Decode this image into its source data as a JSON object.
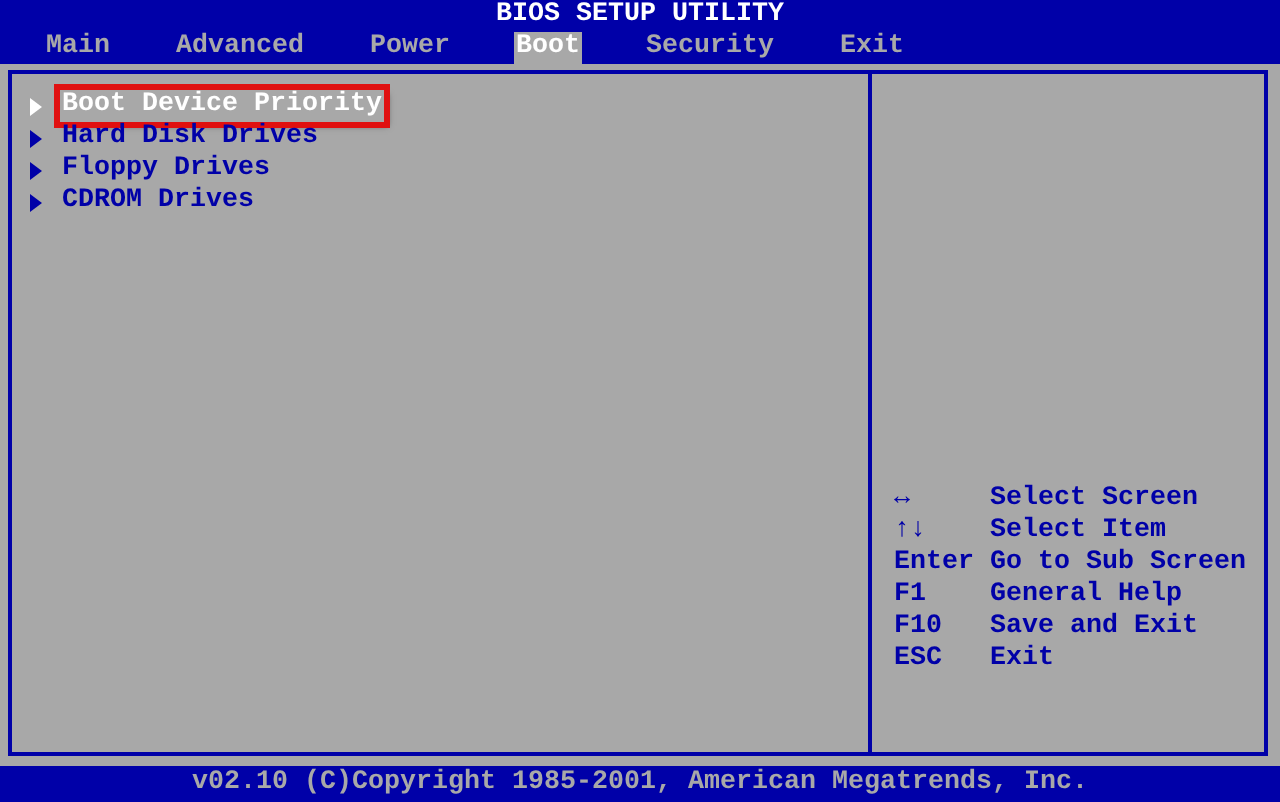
{
  "window": {
    "title": "BIOS SETUP UTILITY"
  },
  "tabs": [
    {
      "label": "Main",
      "selected": false
    },
    {
      "label": "Advanced",
      "selected": false
    },
    {
      "label": "Power",
      "selected": false
    },
    {
      "label": "Boot",
      "selected": true
    },
    {
      "label": "Security",
      "selected": false
    },
    {
      "label": "Exit",
      "selected": false
    }
  ],
  "menu_items": [
    {
      "label": "Boot Device Priority",
      "selected": true,
      "highlighted": true
    },
    {
      "label": "Hard Disk Drives",
      "selected": false,
      "highlighted": false
    },
    {
      "label": "Floppy Drives",
      "selected": false,
      "highlighted": false
    },
    {
      "label": "CDROM Drives",
      "selected": false,
      "highlighted": false
    }
  ],
  "help": [
    {
      "key": "↔",
      "action": "Select Screen"
    },
    {
      "key": "↑↓",
      "action": "Select Item"
    },
    {
      "key": "Enter",
      "action": "Go to Sub Screen"
    },
    {
      "key": "F1",
      "action": "General Help"
    },
    {
      "key": "F10",
      "action": "Save and Exit"
    },
    {
      "key": "ESC",
      "action": "Exit"
    }
  ],
  "status_bar": "v02.10 (C)Copyright 1985-2001, American Megatrends, Inc."
}
